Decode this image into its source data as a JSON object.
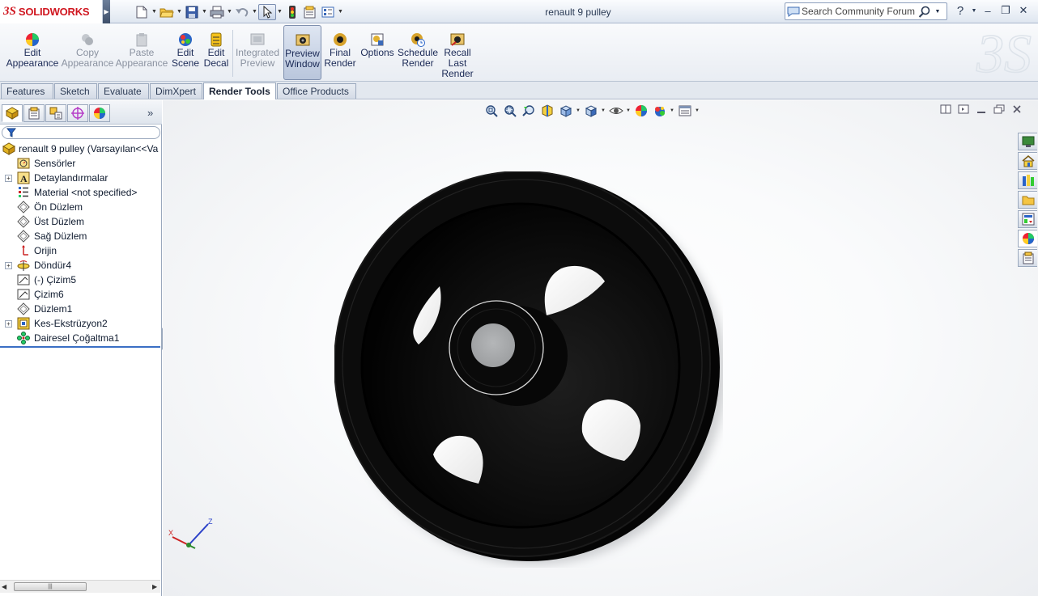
{
  "app": {
    "brand_mark": "3S",
    "brand_name": "SOLIDWORKS",
    "window_title": "renault 9 pulley"
  },
  "search": {
    "placeholder": "Search Community Forum"
  },
  "title_icons": [
    "new-document-icon",
    "open-folder-icon",
    "save-icon",
    "print-icon",
    "undo-icon",
    "select-arrow-icon",
    "rebuild-traffic-light-icon",
    "file-properties-icon",
    "options-icon"
  ],
  "window_controls": {
    "help": "?",
    "minimize": "–",
    "restore": "❐",
    "close": "✕"
  },
  "command_manager": {
    "edit_appearance": {
      "line1": "Edit",
      "line2": "Appearance"
    },
    "copy_appearance": {
      "line1": "Copy",
      "line2": "Appearance"
    },
    "paste_appearance": {
      "line1": "Paste",
      "line2": "Appearance"
    },
    "edit_scene": {
      "line1": "Edit",
      "line2": "Scene"
    },
    "edit_decal": {
      "line1": "Edit",
      "line2": "Decal"
    },
    "integrated_preview": {
      "line1": "Integrated",
      "line2": "Preview"
    },
    "preview_window": {
      "line1": "Preview",
      "line2": "Window"
    },
    "final_render": {
      "line1": "Final",
      "line2": "Render"
    },
    "options": {
      "line1": "Options"
    },
    "schedule_render": {
      "line1": "Schedule",
      "line2": "Render"
    },
    "recall_last_render": {
      "line1": "Recall",
      "line2": "Last",
      "line3": "Render"
    }
  },
  "tabs": [
    "Features",
    "Sketch",
    "Evaluate",
    "DimXpert",
    "Render Tools",
    "Office Products"
  ],
  "active_tab": "Render Tools",
  "panel_tab_icons": [
    "featuremanager-tree-icon",
    "propertymanager-icon",
    "configurationmanager-icon",
    "dimxpertmanager-icon",
    "displaymanager-icon"
  ],
  "panel_more": "»",
  "tree": {
    "root": "renault 9 pulley  (Varsayılan<<Va",
    "items": [
      {
        "label": "Sensörler",
        "icon": "sensor-icon",
        "expandable": false
      },
      {
        "label": "Detaylandırmalar",
        "icon": "annotations-icon",
        "expandable": true
      },
      {
        "label": "Material <not specified>",
        "icon": "material-icon",
        "expandable": false
      },
      {
        "label": "Ön Düzlem",
        "icon": "plane-icon",
        "expandable": false
      },
      {
        "label": "Üst Düzlem",
        "icon": "plane-icon",
        "expandable": false
      },
      {
        "label": "Sağ Düzlem",
        "icon": "plane-icon",
        "expandable": false
      },
      {
        "label": "Orijin",
        "icon": "origin-icon",
        "expandable": false
      },
      {
        "label": "Döndür4",
        "icon": "revolve-icon",
        "expandable": true
      },
      {
        "label": "(-) Çizim5",
        "icon": "sketch-icon",
        "expandable": false
      },
      {
        "label": "Çizim6",
        "icon": "sketch-icon",
        "expandable": false
      },
      {
        "label": "Düzlem1",
        "icon": "plane-icon",
        "expandable": false
      },
      {
        "label": "Kes-Ekstrüzyon2",
        "icon": "cut-extrude-icon",
        "expandable": true
      },
      {
        "label": "Dairesel Çoğaltma1",
        "icon": "circular-pattern-icon",
        "expandable": false
      }
    ]
  },
  "heads_up_icons": [
    "zoom-to-fit-icon",
    "zoom-to-area-icon",
    "previous-view-icon",
    "section-view-icon",
    "view-orientation-icon",
    "display-style-icon",
    "hide-show-items-icon",
    "edit-appearance-icon",
    "apply-scene-icon",
    "view-settings-icon"
  ],
  "viewport_controls": [
    "tile-horizontal-icon",
    "tile-vertical-icon",
    "minimize-icon",
    "restore-icon",
    "close-icon"
  ],
  "task_pane_icons": [
    "solidworks-resources-icon",
    "home-icon",
    "design-library-icon",
    "file-explorer-icon",
    "view-palette-icon",
    "appearances-scenes-icon",
    "custom-properties-icon"
  ],
  "triad": {
    "x": "X",
    "z": "Z"
  },
  "colors": {
    "brand_red": "#d0161f",
    "part_color": "#0a0a0a",
    "hub_color": "#a7a9ab"
  }
}
